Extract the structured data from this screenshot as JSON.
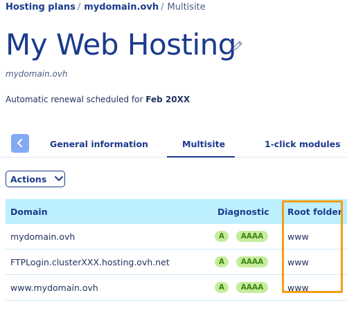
{
  "breadcrumb": {
    "items": [
      "Hosting plans",
      "mydomain.ovh"
    ],
    "separator": "/",
    "current": "Multisite"
  },
  "header": {
    "title": "My Web Hosting",
    "subtitle": "mydomain.ovh",
    "renewal_prefix": "Automatic renewal scheduled for ",
    "renewal_date": "Feb 20XX"
  },
  "tabs": {
    "items": [
      "General information",
      "Multisite",
      "1-click modules"
    ],
    "active": "Multisite"
  },
  "toolbar": {
    "actions_label": "Actions"
  },
  "table": {
    "columns": [
      "Domain",
      "Diagnostic",
      "Root folder"
    ],
    "rows": [
      {
        "domain": "mydomain.ovh",
        "diag_a": "A",
        "diag_aaaa": "AAAA",
        "root": "www"
      },
      {
        "domain": "FTPLogin.clusterXXX.hosting.ovh.net",
        "diag_a": "A",
        "diag_aaaa": "AAAA",
        "root": "www"
      },
      {
        "domain": "www.mydomain.ovh",
        "diag_a": "A",
        "diag_aaaa": "AAAA",
        "root": "www"
      }
    ]
  },
  "icons": {
    "edit": "pencil-icon",
    "back": "chevron-left-icon",
    "dropdown": "chevron-down-icon"
  },
  "colors": {
    "brand": "#1b3a8c",
    "table_header": "#bdf0ff",
    "badge_bg": "#c6ec9c",
    "badge_text": "#3b8612",
    "highlight": "#f39c12",
    "back_button": "#83a9f4"
  }
}
